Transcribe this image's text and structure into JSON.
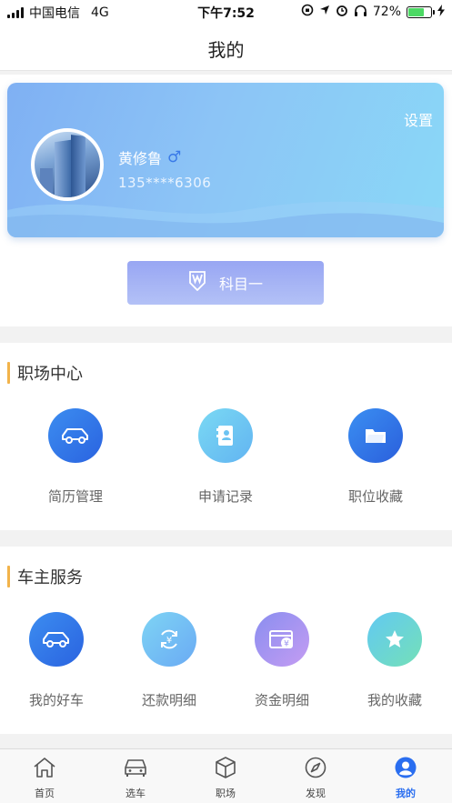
{
  "status_bar": {
    "carrier": "中国电信",
    "network": "4G",
    "time": "下午7:52",
    "battery": "72%"
  },
  "header": {
    "title": "我的"
  },
  "profile": {
    "settings_label": "设置",
    "name": "黄修鲁",
    "gender_symbol": "♂",
    "phone": "135****6306",
    "subject_button": "科目一"
  },
  "career": {
    "title": "职场中心",
    "items": [
      {
        "label": "简历管理",
        "icon": "car-icon"
      },
      {
        "label": "申请记录",
        "icon": "contact-book-icon"
      },
      {
        "label": "职位收藏",
        "icon": "folder-icon"
      }
    ]
  },
  "owner": {
    "title": "车主服务",
    "items": [
      {
        "label": "我的好车",
        "icon": "car-icon"
      },
      {
        "label": "还款明细",
        "icon": "yen-refresh-icon"
      },
      {
        "label": "资金明细",
        "icon": "yen-card-icon"
      },
      {
        "label": "我的收藏",
        "icon": "star-icon"
      }
    ]
  },
  "tabs": [
    {
      "label": "首页",
      "icon": "home-icon"
    },
    {
      "label": "选车",
      "icon": "car-icon"
    },
    {
      "label": "职场",
      "icon": "cube-icon"
    },
    {
      "label": "发现",
      "icon": "compass-icon"
    },
    {
      "label": "我的",
      "icon": "user-icon",
      "active": true
    }
  ],
  "colors": {
    "accent": "#2a6ef0",
    "section_bar": "#f2b34a",
    "card_start": "#7fb0f3",
    "card_end": "#8ad8f7"
  }
}
